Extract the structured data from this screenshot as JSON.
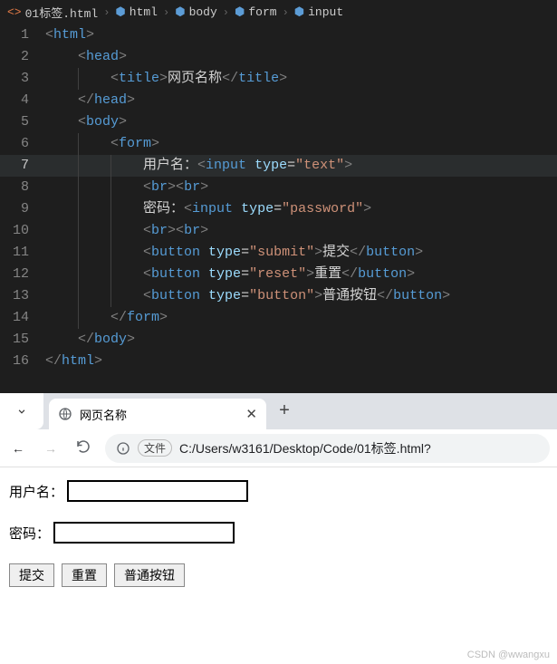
{
  "breadcrumb": {
    "file": "01标签.html",
    "items": [
      "html",
      "body",
      "form",
      "input"
    ]
  },
  "code": {
    "lines": {
      "1": {
        "open": "<",
        "tag": "html",
        "close": ">"
      },
      "2": {
        "open": "<",
        "tag": "head",
        "close": ">"
      },
      "3": {
        "open": "<",
        "tag": "title",
        "mid": ">",
        "text": "网页名称",
        "copen": "</",
        "close": ">"
      },
      "4": {
        "open": "</",
        "tag": "head",
        "close": ">"
      },
      "5": {
        "open": "<",
        "tag": "body",
        "close": ">"
      },
      "6": {
        "open": "<",
        "tag": "form",
        "close": ">"
      },
      "7": {
        "label": "用户名：",
        "open": "<",
        "tag": "input",
        "attr": "type",
        "eq": "=",
        "str": "\"text\"",
        "close": ">"
      },
      "8": {
        "open": "<",
        "tag": "br",
        "close": ">"
      },
      "9": {
        "label": "密码：",
        "open": "<",
        "tag": "input",
        "attr": "type",
        "eq": "=",
        "str": "\"password\"",
        "close": ">"
      },
      "10": {
        "open": "<",
        "tag": "br",
        "close": ">"
      },
      "11": {
        "open": "<",
        "tag": "button",
        "attr": "type",
        "eq": "=",
        "str": "\"submit\"",
        "mid": ">",
        "text": "提交",
        "copen": "</",
        "close": ">"
      },
      "12": {
        "open": "<",
        "tag": "button",
        "attr": "type",
        "eq": "=",
        "str": "\"reset\"",
        "mid": ">",
        "text": "重置",
        "copen": "</",
        "close": ">"
      },
      "13": {
        "open": "<",
        "tag": "button",
        "attr": "type",
        "eq": "=",
        "str": "\"button\"",
        "mid": ">",
        "text": "普通按钮",
        "copen": "</",
        "close": ">"
      },
      "14": {
        "open": "</",
        "tag": "form",
        "close": ">"
      },
      "15": {
        "open": "</",
        "tag": "body",
        "close": ">"
      },
      "16": {
        "open": "</",
        "tag": "html",
        "close": ">"
      }
    },
    "nums": [
      "1",
      "2",
      "3",
      "4",
      "5",
      "6",
      "7",
      "8",
      "9",
      "10",
      "11",
      "12",
      "13",
      "14",
      "15",
      "16"
    ]
  },
  "browser": {
    "tabTitle": "网页名称",
    "fileChip": "文件",
    "url": "C:/Users/w3161/Desktop/Code/01标签.html?"
  },
  "page": {
    "usernameLabel": "用户名：",
    "passwordLabel": "密码：",
    "submit": "提交",
    "reset": "重置",
    "button": "普通按钮"
  },
  "watermark": "CSDN @wwangxu"
}
